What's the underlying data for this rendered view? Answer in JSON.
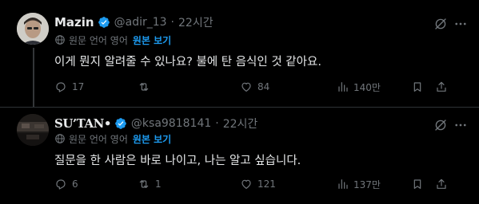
{
  "colors": {
    "background": "#000000",
    "text": "#e7e9ea",
    "muted": "#71767b",
    "accent": "#1d9bf0",
    "verified": "#1d9bf0"
  },
  "tweets": [
    {
      "author_name": "Mazin",
      "handle": "@adir_13",
      "dot": "·",
      "time": "22시간",
      "translate_label": "원문 언어 영어",
      "show_original": "원본 보기",
      "text": "이게 뭔지 알려줄 수 있나요? 불에 탄 음식인 것 같아요.",
      "replies": "17",
      "retweets": "",
      "likes": "84",
      "views": "140만",
      "icons": [
        "verified-badge-icon",
        "globe-icon",
        "grok-icon",
        "more-icon",
        "reply-icon",
        "retweet-icon",
        "like-icon",
        "views-icon",
        "bookmark-icon",
        "share-icon"
      ]
    },
    {
      "author_name": "SU’TAN•",
      "handle": "@ksa9818141",
      "dot": "·",
      "time": "22시간",
      "translate_label": "원문 언어 영어",
      "show_original": "원본 보기",
      "text": "질문을 한 사람은 바로 나이고, 나는 알고 싶습니다.",
      "replies": "6",
      "retweets": "1",
      "likes": "121",
      "views": "137만",
      "icons": [
        "verified-badge-icon",
        "globe-icon",
        "grok-icon",
        "more-icon",
        "reply-icon",
        "retweet-icon",
        "like-icon",
        "views-icon",
        "bookmark-icon",
        "share-icon"
      ]
    }
  ]
}
